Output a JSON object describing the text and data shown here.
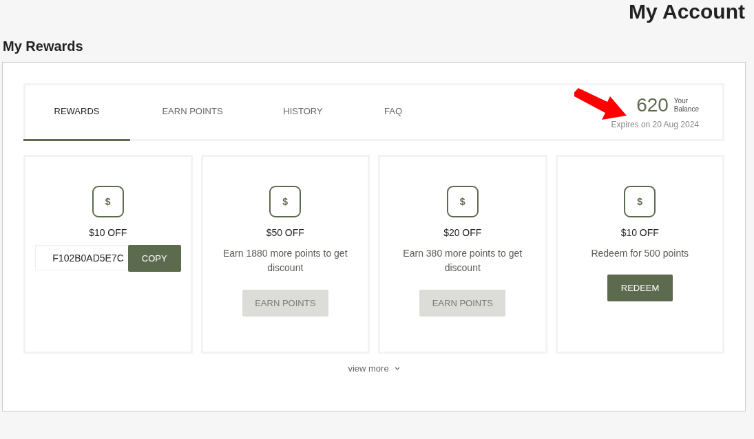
{
  "page_title": "My Account",
  "section_title": "My Rewards",
  "tabs": [
    {
      "label": "REWARDS",
      "selected": true
    },
    {
      "label": "EARN POINTS",
      "selected": false
    },
    {
      "label": "HISTORY",
      "selected": false
    },
    {
      "label": "FAQ",
      "selected": false
    }
  ],
  "balance": {
    "points": "620",
    "label_line_1": "Your",
    "label_line_2": "Balance",
    "expiry": "Expires on 20 Aug 2024"
  },
  "rewards": [
    {
      "kind": "code",
      "icon": "$",
      "title": "$10 OFF",
      "code": "F102B0AD5E7C",
      "button": "COPY",
      "disabled": false
    },
    {
      "kind": "earn",
      "icon": "$",
      "title": "$50 OFF",
      "description": "Earn 1880 more points to get discount",
      "button": "EARN POINTS",
      "disabled": true
    },
    {
      "kind": "earn",
      "icon": "$",
      "title": "$20 OFF",
      "description": "Earn 380 more points to get discount",
      "button": "EARN POINTS",
      "disabled": true
    },
    {
      "kind": "redeem",
      "icon": "$",
      "title": "$10 OFF",
      "description": "Redeem for 500 points",
      "button": "REDEEM",
      "disabled": false
    }
  ],
  "view_more": "view more"
}
